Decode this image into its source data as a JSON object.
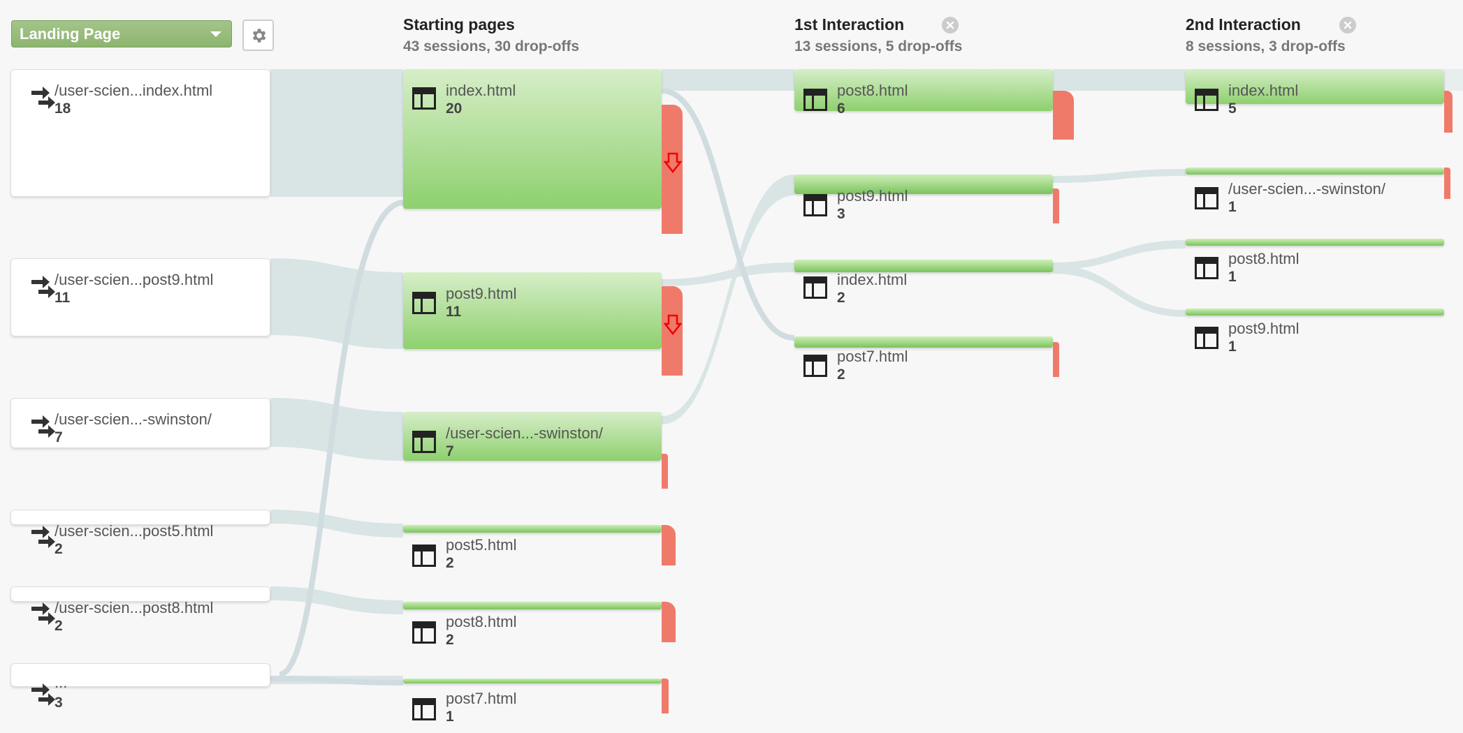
{
  "dimension": {
    "label": "Landing Page"
  },
  "columns": [
    {
      "title": "Starting pages",
      "subtitle": "43 sessions, 30 drop-offs"
    },
    {
      "title": "1st Interaction",
      "subtitle": "13 sessions, 5 drop-offs"
    },
    {
      "title": "2nd Interaction",
      "subtitle": "8 sessions, 3 drop-offs"
    }
  ],
  "landing_pages": [
    {
      "label": "/user-scien...index.html",
      "count": "18"
    },
    {
      "label": "/user-scien...post9.html",
      "count": "11"
    },
    {
      "label": "/user-scien...-swinston/",
      "count": "7"
    },
    {
      "label": "/user-scien...post5.html",
      "count": "2"
    },
    {
      "label": "/user-scien...post8.html",
      "count": "2"
    },
    {
      "label": "...",
      "count": "3"
    }
  ],
  "starting_pages": [
    {
      "label": "index.html",
      "count": "20"
    },
    {
      "label": "post9.html",
      "count": "11"
    },
    {
      "label": "/user-scien...-swinston/",
      "count": "7"
    },
    {
      "label": "post5.html",
      "count": "2"
    },
    {
      "label": "post8.html",
      "count": "2"
    },
    {
      "label": "post7.html",
      "count": "1"
    }
  ],
  "first_interaction": [
    {
      "label": "post8.html",
      "count": "6"
    },
    {
      "label": "post9.html",
      "count": "3"
    },
    {
      "label": "index.html",
      "count": "2"
    },
    {
      "label": "post7.html",
      "count": "2"
    }
  ],
  "second_interaction": [
    {
      "label": "index.html",
      "count": "5"
    },
    {
      "label": "/user-scien...-swinston/",
      "count": "1"
    },
    {
      "label": "post8.html",
      "count": "1"
    },
    {
      "label": "post9.html",
      "count": "1"
    }
  ],
  "colors": {
    "node_green": "#8ed06e",
    "dropoff_red": "#f07a6a",
    "flow": "#d7e2e4"
  }
}
